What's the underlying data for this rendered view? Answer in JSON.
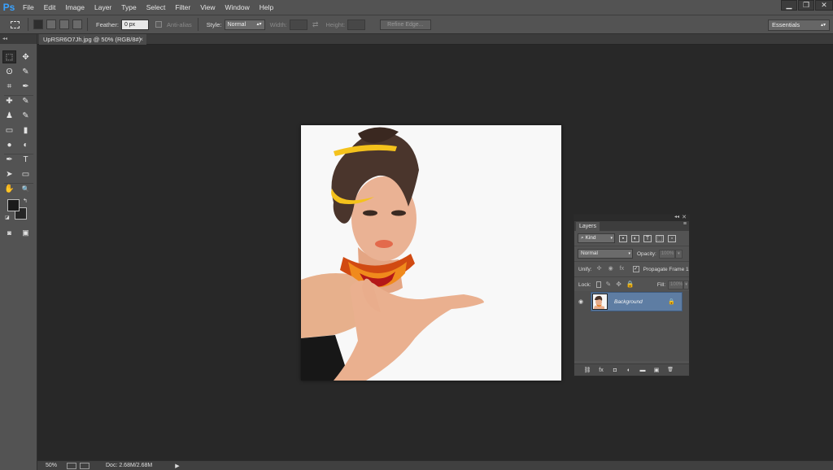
{
  "app": {
    "logo_text": "Ps"
  },
  "menu": [
    "File",
    "Edit",
    "Image",
    "Layer",
    "Type",
    "Select",
    "Filter",
    "View",
    "Window",
    "Help"
  ],
  "window_controls": {
    "minimize": "▁",
    "restore": "❐",
    "close": "✕"
  },
  "options": {
    "feather_label": "Feather:",
    "feather_value": "0 px",
    "antialias_label": "Anti-alias",
    "style_label": "Style:",
    "style_value": "Normal",
    "width_label": "Width:",
    "height_label": "Height:",
    "refine_edge": "Refine Edge...",
    "workspace": "Essentials"
  },
  "document": {
    "tab_title": "UpRSR6O7Jh.jpg @ 50% (RGB/8#)",
    "tab_close": "×"
  },
  "toolbar": {
    "head": "◂◂",
    "tools": [
      [
        "⬚",
        "✥"
      ],
      [
        "ʘ",
        "✎"
      ],
      [
        "⌗",
        "✒"
      ],
      [
        "✚",
        "✎"
      ],
      [
        "♟",
        "✎"
      ],
      [
        "▭",
        "▮"
      ],
      [
        "●",
        "◐"
      ],
      [
        "✒",
        "T"
      ],
      [
        "➤",
        "▭"
      ],
      [
        "✋",
        "🔍"
      ]
    ],
    "mask_tool": "◙",
    "screen_mode": "▣"
  },
  "status": {
    "zoom": "50%",
    "doc_size": "Doc: 2.68M/2.68M",
    "arrow": "▶"
  },
  "layers_panel": {
    "tab": "Layers",
    "menu_icon": "≡",
    "collapse": "◂◂",
    "close": "✕",
    "kind_value": "⌕ Kind",
    "blend_mode": "Normal",
    "opacity_label": "Opacity:",
    "opacity_value": "100%",
    "unify_label": "Unify:",
    "propagate_label": "Propagate Frame 1",
    "lock_label": "Lock:",
    "fill_label": "Fill:",
    "fill_value": "100%",
    "layer_name": "Background",
    "bottom_icons": [
      "⛓",
      "fx",
      "◘",
      "◐",
      "▬",
      "▣",
      "🗑"
    ]
  },
  "colors": {
    "brand": "#39a2ff",
    "selected_layer": "#5e7da3",
    "workspace_bg": "#282828",
    "panel_bg": "#535353"
  }
}
